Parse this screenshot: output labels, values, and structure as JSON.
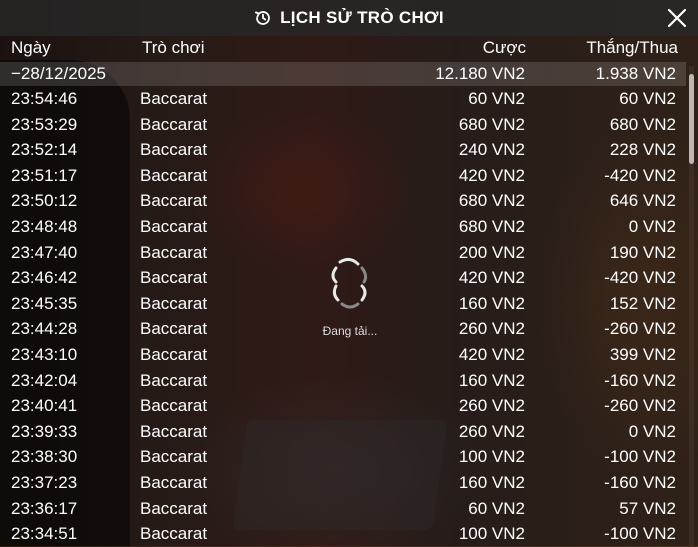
{
  "header": {
    "title": "LỊCH SỬ TRÒ CHƠI",
    "icon": "history-icon",
    "close_icon": "close-icon"
  },
  "columns": {
    "date": "Ngày",
    "game": "Trò chơi",
    "bet": "Cược",
    "winloss": "Thắng/Thua"
  },
  "summary": {
    "date": "−28/12/2025",
    "bet": "12.180 VN2",
    "winloss": "1.938 VN2"
  },
  "rows": [
    {
      "time": "23:54:46",
      "game": "Baccarat",
      "bet": "60 VN2",
      "winloss": "60 VN2"
    },
    {
      "time": "23:53:29",
      "game": "Baccarat",
      "bet": "680 VN2",
      "winloss": "680 VN2"
    },
    {
      "time": "23:52:14",
      "game": "Baccarat",
      "bet": "240 VN2",
      "winloss": "228 VN2"
    },
    {
      "time": "23:51:17",
      "game": "Baccarat",
      "bet": "420 VN2",
      "winloss": "-420 VN2"
    },
    {
      "time": "23:50:12",
      "game": "Baccarat",
      "bet": "680 VN2",
      "winloss": "646 VN2"
    },
    {
      "time": "23:48:48",
      "game": "Baccarat",
      "bet": "680 VN2",
      "winloss": "0 VN2"
    },
    {
      "time": "23:47:40",
      "game": "Baccarat",
      "bet": "200 VN2",
      "winloss": "190 VN2"
    },
    {
      "time": "23:46:42",
      "game": "Baccarat",
      "bet": "420 VN2",
      "winloss": "-420 VN2"
    },
    {
      "time": "23:45:35",
      "game": "Baccarat",
      "bet": "160 VN2",
      "winloss": "152 VN2"
    },
    {
      "time": "23:44:28",
      "game": "Baccarat",
      "bet": "260 VN2",
      "winloss": "-260 VN2"
    },
    {
      "time": "23:43:10",
      "game": "Baccarat",
      "bet": "420 VN2",
      "winloss": "399 VN2"
    },
    {
      "time": "23:42:04",
      "game": "Baccarat",
      "bet": "160 VN2",
      "winloss": "-160 VN2"
    },
    {
      "time": "23:40:41",
      "game": "Baccarat",
      "bet": "260 VN2",
      "winloss": "-260 VN2"
    },
    {
      "time": "23:39:33",
      "game": "Baccarat",
      "bet": "260 VN2",
      "winloss": "0 VN2"
    },
    {
      "time": "23:38:30",
      "game": "Baccarat",
      "bet": "100 VN2",
      "winloss": "-100 VN2"
    },
    {
      "time": "23:37:23",
      "game": "Baccarat",
      "bet": "160 VN2",
      "winloss": "-160 VN2"
    },
    {
      "time": "23:36:17",
      "game": "Baccarat",
      "bet": "60 VN2",
      "winloss": "57 VN2"
    },
    {
      "time": "23:34:51",
      "game": "Baccarat",
      "bet": "100 VN2",
      "winloss": "-100 VN2"
    }
  ],
  "loading": {
    "text": "Đang tải...",
    "icon": "spinner-icon"
  }
}
